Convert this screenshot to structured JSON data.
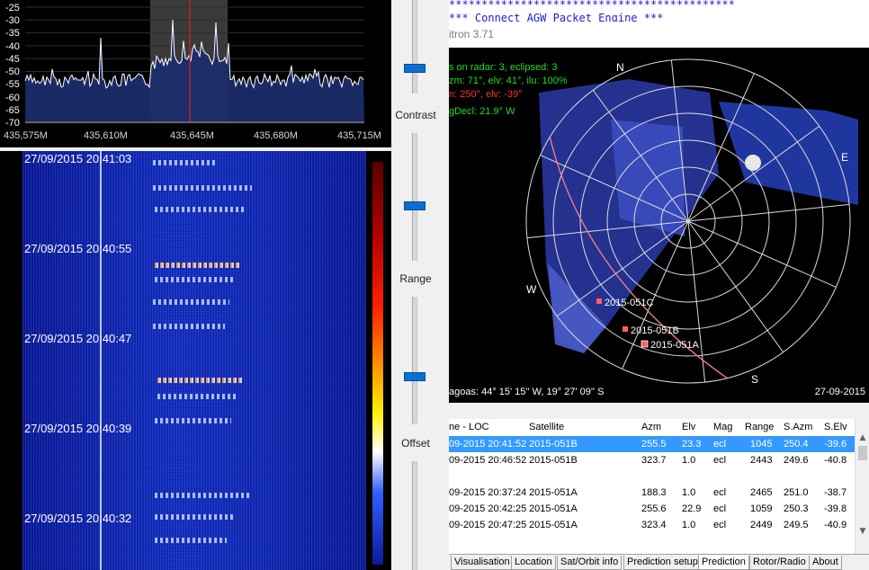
{
  "spectrum": {
    "y_ticks": [
      "-25",
      "-30",
      "-35",
      "-40",
      "-45",
      "-50",
      "-55",
      "-60",
      "-65",
      "-70"
    ],
    "x_ticks": [
      "435,575M",
      "435,610M",
      "435,645M",
      "435,680M",
      "435,715M"
    ]
  },
  "waterfall": {
    "timestamps": [
      "27/09/2015 20:41:03",
      "27/09/2015 20:40:55",
      "27/09/2015 20:40:47",
      "27/09/2015 20:40:39",
      "27/09/2015 20:40:32"
    ]
  },
  "sliders": {
    "contrast_label": "Contrast",
    "range_label": "Range",
    "offset_label": "Offset"
  },
  "terminal": {
    "line1": "********************************************",
    "line2": "***  Connect AGW Packet Engine  ***"
  },
  "orbitron": {
    "title": "itron 3.71",
    "radar": {
      "info1": "s on radar: 3, eclipsed: 3",
      "info2": "zm: 71°, elv: 41°, ilu: 100%",
      "info3": "n: 250°, elv: -39°",
      "info4": "gDecl: 21.9° W",
      "north": "N",
      "east": "E",
      "south": "S",
      "west": "W",
      "sats": [
        "2015-051C",
        "2015-051B",
        "2015-051A"
      ],
      "coords": "agoas: 44° 15' 15'' W, 19° 27' 09'' S",
      "date": "27-09-2015"
    },
    "table": {
      "headers": [
        "ne - LOC",
        "Satellite",
        "Azm",
        "Elv",
        "Mag",
        "Range",
        "S.Azm",
        "S.Elv"
      ],
      "rows": [
        [
          "09-2015 20:41:52",
          "2015-051B",
          "255.5",
          "23.3",
          "ecl",
          "1045",
          "250.4",
          "-39.6"
        ],
        [
          "09-2015 20:46:52",
          "2015-051B",
          "323.7",
          "1.0",
          "ecl",
          "2443",
          "249.6",
          "-40.8"
        ],
        [
          "",
          "",
          "",
          "",
          "",
          "",
          "",
          ""
        ],
        [
          "09-2015 20:37:24",
          "2015-051A",
          "188.3",
          "1.0",
          "ecl",
          "2465",
          "251.0",
          "-38.7"
        ],
        [
          "09-2015 20:42:25",
          "2015-051A",
          "255.6",
          "22.9",
          "ecl",
          "1059",
          "250.3",
          "-39.8"
        ],
        [
          "09-2015 20:47:25",
          "2015-051A",
          "323.4",
          "1.0",
          "ecl",
          "2449",
          "249.5",
          "-40.9"
        ]
      ]
    },
    "tabs": [
      "Visualisation",
      "Location",
      "Sat/Orbit info",
      "Prediction setup",
      "Prediction",
      "Rotor/Radio",
      "About"
    ],
    "active_tab": "Prediction",
    "colors": {
      "selection": "#3399ff",
      "terminal_text": "#2020c8",
      "radar_info": "#22dd22",
      "radar_warn": "#ff3030"
    }
  }
}
